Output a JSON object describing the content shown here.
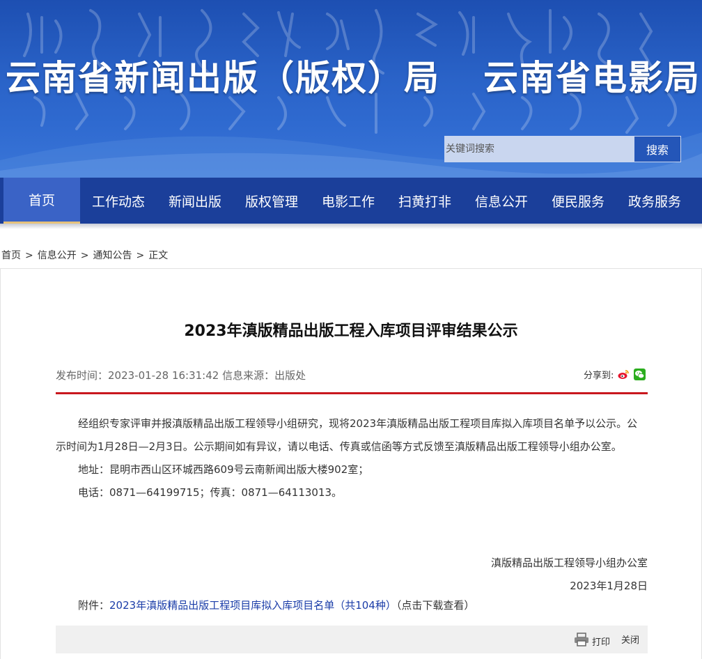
{
  "header": {
    "title_left": "云南省新闻出版（版权）局",
    "title_right": "云南省电影局",
    "search_placeholder": "关键词搜索",
    "search_button": "搜索",
    "colors": {
      "banner": "#2a63c8",
      "nav": "#1b3f9a",
      "nav_active": "#3a63c6",
      "accent_rule": "#c9171e"
    }
  },
  "nav": {
    "items": [
      "首页",
      "工作动态",
      "新闻出版",
      "版权管理",
      "电影工作",
      "扫黄打非",
      "信息公开",
      "便民服务",
      "政务服务"
    ],
    "active": "首页"
  },
  "breadcrumb": [
    "首页",
    "信息公开",
    "通知公告",
    "正文"
  ],
  "breadcrumb_sep": ">",
  "article": {
    "title": "2023年滇版精品出版工程入库项目评审结果公示",
    "meta": "发布时间：2023-01-28 16:31:42 信息来源：出版处",
    "share_label": "分享到:",
    "share_icons": [
      "weibo-icon",
      "wechat-icon"
    ],
    "paragraph1": "经组织专家评审并报滇版精品出版工程领导小组研究，现将2023年滇版精品出版工程项目库拟入库项目名单予以公示。公示时间为1月28日—2月3日。公示期间如有异议，请以电话、传真或信函等方式反馈至滇版精品出版工程领导小组办公室。",
    "address": "地址：昆明市西山区环城西路609号云南新闻出版大楼902室；",
    "phone": "电话：0871—64199715；传真：0871—64113013。",
    "signature": "滇版精品出版工程领导小组办公室",
    "date": "2023年1月28日",
    "attachment_label": "附件：",
    "attachment_link": "2023年滇版精品出版工程项目库拟入库项目名单（共104种）",
    "attachment_hint": "（点击下载查看）"
  },
  "toolbar": {
    "print": "打印",
    "close": "关闭"
  }
}
